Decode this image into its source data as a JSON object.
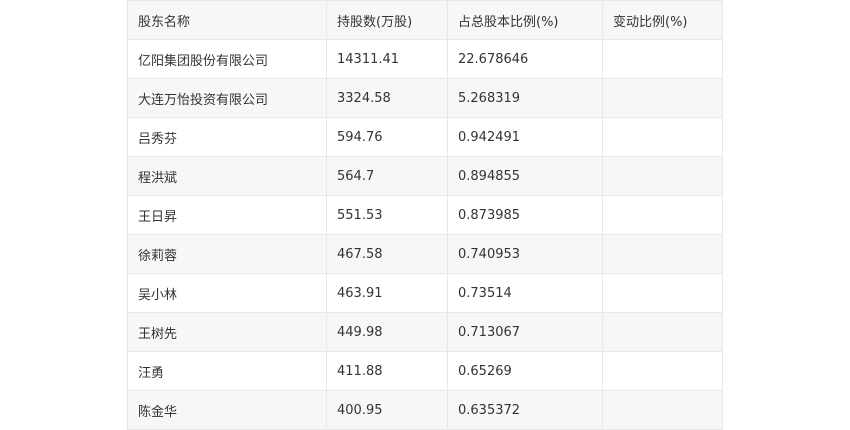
{
  "table": {
    "headers": [
      "股东名称",
      "持股数(万股)",
      "占总股本比例(%)",
      "变动比例(%)"
    ],
    "rows": [
      [
        "亿阳集团股份有限公司",
        "14311.41",
        "22.678646",
        ""
      ],
      [
        "大连万怡投资有限公司",
        "3324.58",
        "5.268319",
        ""
      ],
      [
        "吕秀芬",
        "594.76",
        "0.942491",
        ""
      ],
      [
        "程洪斌",
        "564.7",
        "0.894855",
        ""
      ],
      [
        "王日昇",
        "551.53",
        "0.873985",
        ""
      ],
      [
        "徐莉蓉",
        "467.58",
        "0.740953",
        ""
      ],
      [
        "吴小林",
        "463.91",
        "0.73514",
        ""
      ],
      [
        "王树先",
        "449.98",
        "0.713067",
        ""
      ],
      [
        "汪勇",
        "411.88",
        "0.65269",
        ""
      ],
      [
        "陈金华",
        "400.95",
        "0.635372",
        ""
      ]
    ]
  }
}
